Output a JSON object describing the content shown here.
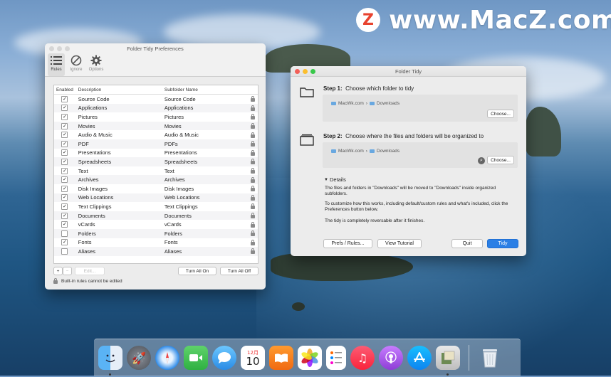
{
  "watermark": {
    "logo_letter": "Z",
    "text": "www.MacZ.com"
  },
  "prefs": {
    "title": "Folder Tidy Preferences",
    "toolbar": [
      {
        "label": "Rules",
        "icon": "list-icon"
      },
      {
        "label": "Ignore",
        "icon": "no-entry-icon"
      },
      {
        "label": "Options",
        "icon": "gear-icon"
      }
    ],
    "columns": {
      "enabled": "Enabled",
      "description": "Description",
      "subfolder": "Subfolder Name"
    },
    "rows": [
      {
        "desc": "Source Code",
        "sub": "Source Code",
        "on": true
      },
      {
        "desc": "Applications",
        "sub": "Applications",
        "on": true
      },
      {
        "desc": "Pictures",
        "sub": "Pictures",
        "on": true
      },
      {
        "desc": "Movies",
        "sub": "Movies",
        "on": true
      },
      {
        "desc": "Audio & Music",
        "sub": "Audio & Music",
        "on": true
      },
      {
        "desc": "PDF",
        "sub": "PDFs",
        "on": true
      },
      {
        "desc": "Presentations",
        "sub": "Presentations",
        "on": true
      },
      {
        "desc": "Spreadsheets",
        "sub": "Spreadsheets",
        "on": true
      },
      {
        "desc": "Text",
        "sub": "Text",
        "on": true
      },
      {
        "desc": "Archives",
        "sub": "Archives",
        "on": true
      },
      {
        "desc": "Disk Images",
        "sub": "Disk Images",
        "on": true
      },
      {
        "desc": "Web Locations",
        "sub": "Web Locations",
        "on": true
      },
      {
        "desc": "Text Clippings",
        "sub": "Text Clippings",
        "on": true
      },
      {
        "desc": "Documents",
        "sub": "Documents",
        "on": true
      },
      {
        "desc": "vCards",
        "sub": "vCards",
        "on": true
      },
      {
        "desc": "Folders",
        "sub": "Folders",
        "on": false
      },
      {
        "desc": "Fonts",
        "sub": "Fonts",
        "on": true
      },
      {
        "desc": "Aliases",
        "sub": "Aliases",
        "on": false
      }
    ],
    "add_label": "+",
    "remove_label": "−",
    "edit_label": "Edit...",
    "turn_all_on": "Turn All On",
    "turn_all_off": "Turn All Off",
    "footer_note": "Built-in rules cannot be edited"
  },
  "main": {
    "title": "Folder Tidy",
    "step1": {
      "prefix": "Step 1:",
      "text": "Choose which folder to tidy",
      "path_root": "MacWk.com",
      "path_sep": "›",
      "path_leaf": "Downloads",
      "choose": "Choose..."
    },
    "step2": {
      "prefix": "Step 2:",
      "text": "Choose where the files and folders will be organized to",
      "path_root": "MacWk.com",
      "path_sep": "›",
      "path_leaf": "Downloads",
      "choose": "Choose..."
    },
    "details_label": "Details",
    "details_p1": "The files and folders in \"Downloads\" will be moved to \"Downloads\" inside organized subfolders.",
    "details_p2": "To customize how this works, including default/custom rules and what's included, click the Preferences button below.",
    "details_p3": "The tidy is completely reversable after it finishes.",
    "buttons": {
      "prefs": "Prefs / Rules...",
      "tutorial": "View Tutorial",
      "quit": "Quit",
      "tidy": "Tidy"
    }
  },
  "dock": {
    "calendar_month": "12月",
    "calendar_day": "10",
    "items": [
      "finder-icon",
      "launchpad-icon",
      "safari-icon",
      "facetime-icon",
      "messages-icon",
      "calendar-icon",
      "books-icon",
      "photos-icon",
      "reminders-icon",
      "music-icon",
      "podcasts-icon",
      "app-store-icon",
      "archive-utility-icon",
      "trash-icon"
    ]
  }
}
